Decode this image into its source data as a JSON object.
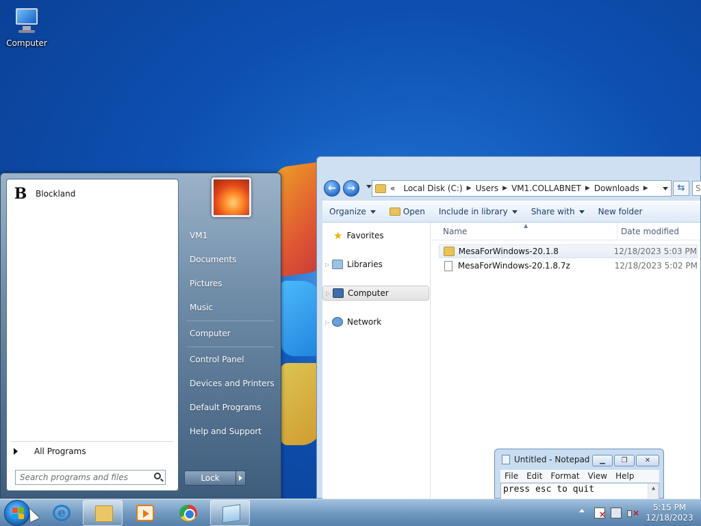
{
  "desktop": {
    "icons": [
      {
        "label": "Computer",
        "icon": "computer-icon"
      }
    ]
  },
  "explorer": {
    "breadcrumbs": [
      "Local Disk (C:)",
      "Users",
      "VM1.COLLABNET",
      "Downloads"
    ],
    "address_prefix": "«",
    "search_placeholder": "S",
    "toolbar": {
      "organize": "Organize",
      "open": "Open",
      "include_in_library": "Include in library",
      "share_with": "Share with",
      "new_folder": "New folder"
    },
    "nav": {
      "favorites": "Favorites",
      "libraries": "Libraries",
      "computer": "Computer",
      "network": "Network"
    },
    "columns": {
      "name": "Name",
      "date_modified": "Date modified"
    },
    "files": [
      {
        "name": "MesaForWindows-20.1.8",
        "date": "12/18/2023 5:03 PM",
        "type": "folder"
      },
      {
        "name": "MesaForWindows-20.1.8.7z",
        "date": "12/18/2023 5:02 PM",
        "type": "file"
      }
    ]
  },
  "start_menu": {
    "pinned": [
      {
        "label": "Blockland",
        "icon_glyph": "B"
      }
    ],
    "all_programs": "All Programs",
    "search_placeholder": "Search programs and files",
    "right_links": {
      "user": "VM1",
      "documents": "Documents",
      "pictures": "Pictures",
      "music": "Music",
      "computer": "Computer",
      "control_panel": "Control Panel",
      "devices_printers": "Devices and Printers",
      "default_programs": "Default Programs",
      "help_support": "Help and Support"
    },
    "lock": "Lock"
  },
  "notepad": {
    "title": "Untitled - Notepad",
    "menu": [
      "File",
      "Edit",
      "Format",
      "View",
      "Help"
    ],
    "content": "press esc to quit"
  },
  "taskbar": {
    "apps": [
      "start-orb",
      "internet-explorer",
      "windows-explorer",
      "windows-media-player",
      "google-chrome",
      "notepad"
    ],
    "clock_time": "5:15 PM",
    "clock_date": "12/18/2023"
  },
  "colors": {
    "accent": "#1a7fd6",
    "taskbar": "#7aa0c3",
    "start_menu": "#6d8aa6"
  }
}
